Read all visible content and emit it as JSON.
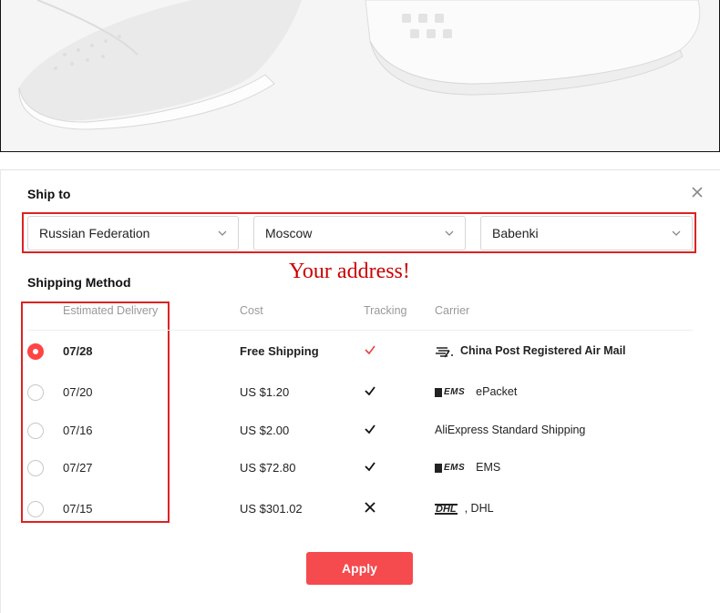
{
  "ship_to": {
    "title": "Ship to",
    "country": "Russian Federation",
    "city": "Moscow",
    "district": "Babenki",
    "annotation": "Your address!"
  },
  "shipping": {
    "title": "Shipping Method",
    "headers": {
      "delivery": "Estimated Delivery",
      "cost": "Cost",
      "tracking": "Tracking",
      "carrier": "Carrier"
    },
    "rows": [
      {
        "date": "07/28",
        "cost": "Free Shipping",
        "tracking": "check",
        "carrier": "China Post Registered Air Mail",
        "logo": "china-post-logo",
        "selected": true
      },
      {
        "date": "07/20",
        "cost": "US $1.20",
        "tracking": "check",
        "carrier": "ePacket",
        "logo": "EMS"
      },
      {
        "date": "07/16",
        "cost": "US $2.00",
        "tracking": "check",
        "carrier": "AliExpress Standard Shipping",
        "logo": ""
      },
      {
        "date": "07/27",
        "cost": "US $72.80",
        "tracking": "check",
        "carrier": "EMS",
        "logo": "EMS"
      },
      {
        "date": "07/15",
        "cost": "US $301.02",
        "tracking": "cross",
        "carrier": ", DHL",
        "logo": "DHL"
      }
    ]
  },
  "apply_label": "Apply",
  "colors": {
    "accent": "#f54a4e",
    "annotation": "#cc0000",
    "check_selected": "#e64340"
  }
}
